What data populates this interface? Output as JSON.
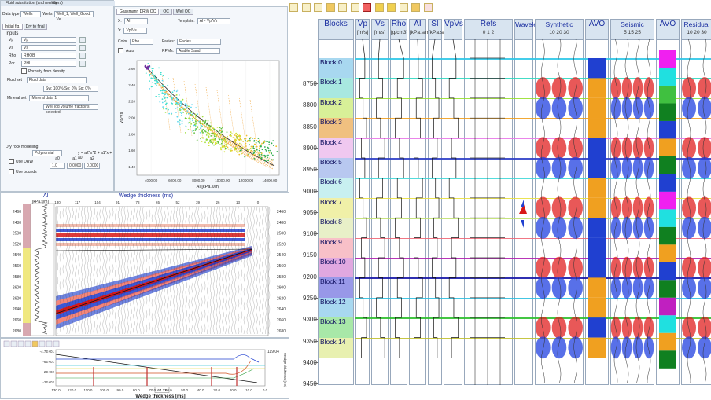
{
  "left_window": {
    "title": "Fluid substitution (and members)",
    "menu_help": "Help",
    "toolbar": {
      "data_type_label": "Data type",
      "data_type_value": "Wells",
      "wells_label": "Wells",
      "wells_value": "Well_1, Well_Good, Ve"
    },
    "tabs": {
      "initial": "Initial fig.",
      "dry": "Dry to final"
    },
    "inputs_title": "Inputs",
    "inputs": [
      {
        "label": "Vp",
        "value": "Vp"
      },
      {
        "label": "Vs",
        "value": "Vs"
      },
      {
        "label": "Rho",
        "value": "RHOB"
      },
      {
        "label": "Por",
        "value": "PHI"
      }
    ],
    "porosity_checkbox": "Porosity from density",
    "fluid_set_label": "Fluid set",
    "fluid_set_value": "Fluid data",
    "fluid_sub_value": "Sw: 100% So: 0% Sg: 0%",
    "mineral_set_label": "Mineral set",
    "mineral_set_value": "Mineral data 1",
    "mineral_sub_value": "Well log volume fractions selected",
    "dry_rock_label": "Dry rock modelling",
    "dry_rock_method": "Polynomial",
    "formula": "y = a2*x^2 + a1*x + a0",
    "use_dryw": "Use DRW",
    "use_bounds": "Use bounds",
    "coef_headers": [
      "a0",
      "a1",
      "a2"
    ],
    "coef_values": [
      "1.0",
      "0.0000",
      "0.0000"
    ]
  },
  "crossplot_window": {
    "tabs": [
      "Gassmann DRW QC",
      "QC",
      "Well QC"
    ],
    "x_label": "X:",
    "x_value": "AI",
    "y_label": "Y:",
    "y_value": "Vp/Vs",
    "template_label": "Template:",
    "template_value": "AI - Vp/Vs",
    "color_label": "Color",
    "color_value": "Rho",
    "facies_label": "Facies:",
    "facies_value": "Facies",
    "auto_label": "Auto",
    "rpm_label": "RPMs:",
    "rpm_value": "Arable Sand",
    "chart_data": {
      "type": "scatter",
      "xlabel": "AI [kPa.s/m]",
      "ylabel": "Vp/Vs",
      "x_ticks": [
        "4000.00",
        "6000.00",
        "8000.00",
        "10000.00",
        "12000.00",
        "14000.00"
      ],
      "y_ticks": [
        "1.40",
        "1.60",
        "1.80",
        "2.00",
        "2.20",
        "2.40",
        "2.60"
      ]
    }
  },
  "wedge": {
    "title": "Wedge thickness (ms)",
    "ai_label": "AI",
    "ai_unit": "[kPa.s/m]",
    "top_ticks": [
      "130",
      "117",
      "104",
      "91",
      "78",
      "65",
      "52",
      "39",
      "26",
      "13",
      "0"
    ],
    "depths_left": [
      "2460",
      "2480",
      "2500",
      "2520",
      "2540",
      "2560",
      "2580",
      "2600",
      "2620",
      "2640",
      "2660",
      "2680"
    ],
    "depths_right": [
      "2460",
      "2480",
      "2500",
      "2520",
      "2540",
      "2560",
      "2580",
      "2600",
      "2620",
      "2640",
      "2660",
      "2680"
    ],
    "tuning_chart": {
      "type": "line",
      "xlabel": "Wedge thickness [ms]",
      "ylabel": "Wedge thickness [ms]",
      "x_ticks": [
        "130.0",
        "120.0",
        "110.0",
        "100.0",
        "90.0",
        "80.0",
        "70.0",
        "60.0",
        "50.0",
        "40.0",
        "30.0",
        "20.0",
        "10.0",
        "0.0"
      ],
      "y_left": [
        "-4.7E+01",
        "-6E+01",
        "-2E+02",
        "-2E+02"
      ],
      "y_right": "119.04",
      "cursor_value": "64.32"
    }
  },
  "right": {
    "columns": [
      {
        "name": "Blocks",
        "unit": ""
      },
      {
        "name": "Vp",
        "unit": "[m/s]"
      },
      {
        "name": "Vs",
        "unit": "[m/s]"
      },
      {
        "name": "Rho",
        "unit": "[g/cm3]"
      },
      {
        "name": "AI",
        "unit": "[kPa.s/m]"
      },
      {
        "name": "SI",
        "unit": "[kPa.s/m]"
      },
      {
        "name": "VpVs",
        "unit": ""
      },
      {
        "name": "Refs",
        "unit": "0    1    2"
      },
      {
        "name": "Wavelet",
        "unit": ""
      },
      {
        "name": "Synthetic",
        "unit": "10   20   30"
      },
      {
        "name": "AVO",
        "unit": ""
      },
      {
        "name": "Seismic",
        "unit": "5   15   25"
      },
      {
        "name": "AVO",
        "unit": ""
      },
      {
        "name": "Residual",
        "unit": "10  20  30"
      }
    ],
    "depths": [
      "8750",
      "8800",
      "8850",
      "8900",
      "8950",
      "9000",
      "9050",
      "9100",
      "9150",
      "9200",
      "9250",
      "9300",
      "9350",
      "9400",
      "9450"
    ],
    "blocks": [
      "Block 0",
      "Block 1",
      "Block 2",
      "Block 3",
      "Block 4",
      "Block 5",
      "Block 6",
      "Block 7",
      "Block 8",
      "Block 9",
      "Block 10",
      "Block 11",
      "Block 12",
      "Block 13",
      "Block 14"
    ],
    "block_colors": [
      "#a8d8f0",
      "#a8e8e0",
      "#d8f098",
      "#f0c080",
      "#f0c8f0",
      "#b8c8f0",
      "#c8f0f0",
      "#f0f0a8",
      "#e8f0c8",
      "#f8c0c8",
      "#e0a8e0",
      "#9898e8",
      "#a8d8f0",
      "#a8e8a8",
      "#e8f0b0"
    ],
    "line_colors": [
      "#30c8e8",
      "#30d8c0",
      "#98e030",
      "#f0a020",
      "#e878e8",
      "#3040c8",
      "#40d8d8",
      "#e8e040",
      "#c0e070",
      "#f06878",
      "#b020b0",
      "#1818a8",
      "#30c0e0",
      "#30c030",
      "#c0c030"
    ]
  }
}
